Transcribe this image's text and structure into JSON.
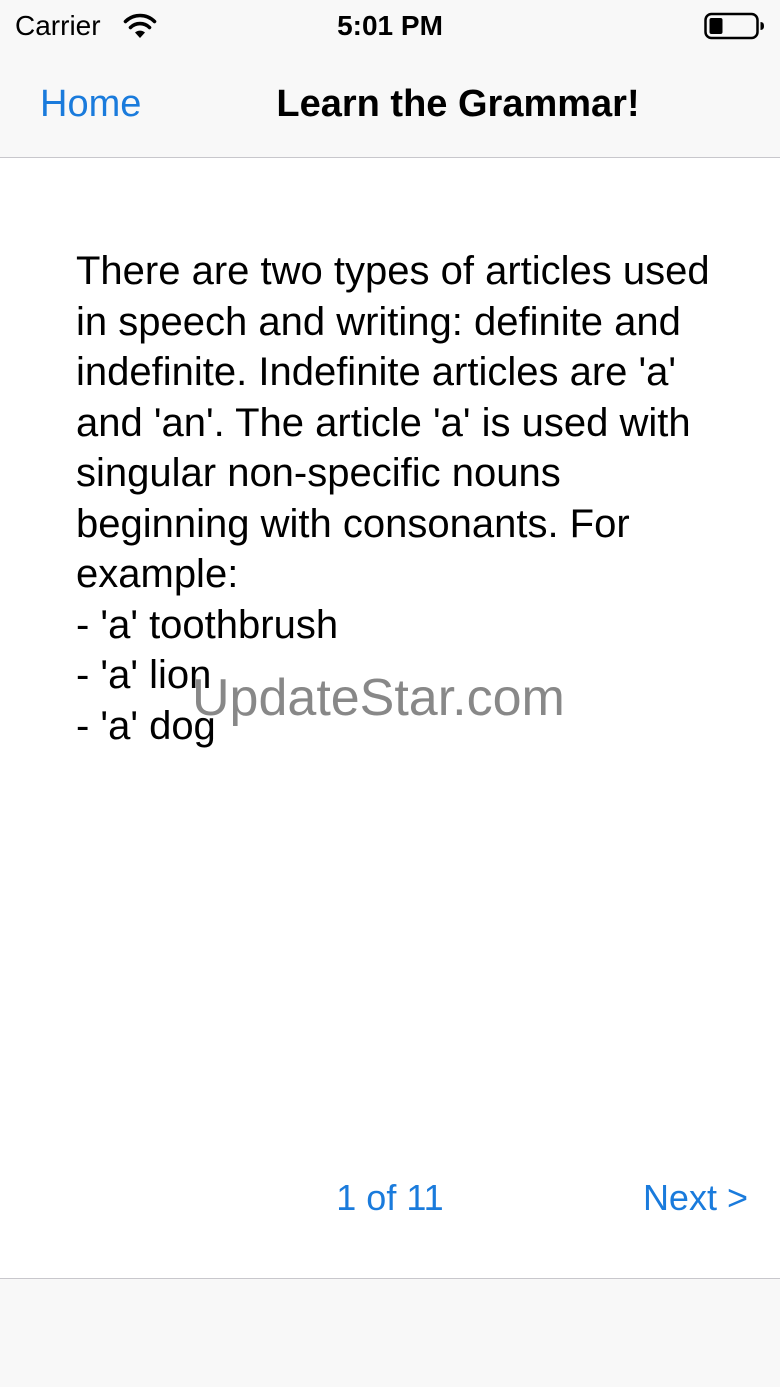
{
  "status_bar": {
    "carrier": "Carrier",
    "time": "5:01 PM",
    "icons": [
      "wifi-icon",
      "battery-icon"
    ]
  },
  "nav": {
    "back_label": "Home",
    "title": "Learn the Grammar!"
  },
  "lesson": {
    "paragraph": "There are two types of articles used in speech and writing: definite and indefinite. Indefinite articles are 'a' and 'an'. The article 'a' is used with singular non-specific nouns beginning with consonants. For example:",
    "examples": [
      "- 'a' toothbrush",
      "- 'a' lion",
      "- 'a' dog"
    ]
  },
  "watermark": "UpdateStar.com",
  "pager": {
    "indicator": "1 of 11",
    "next_label": "Next",
    "next_chevron": ">"
  },
  "colors": {
    "accent": "#1a7bdc",
    "bar_background": "#f8f8f8",
    "separator": "#c8c7cc"
  }
}
